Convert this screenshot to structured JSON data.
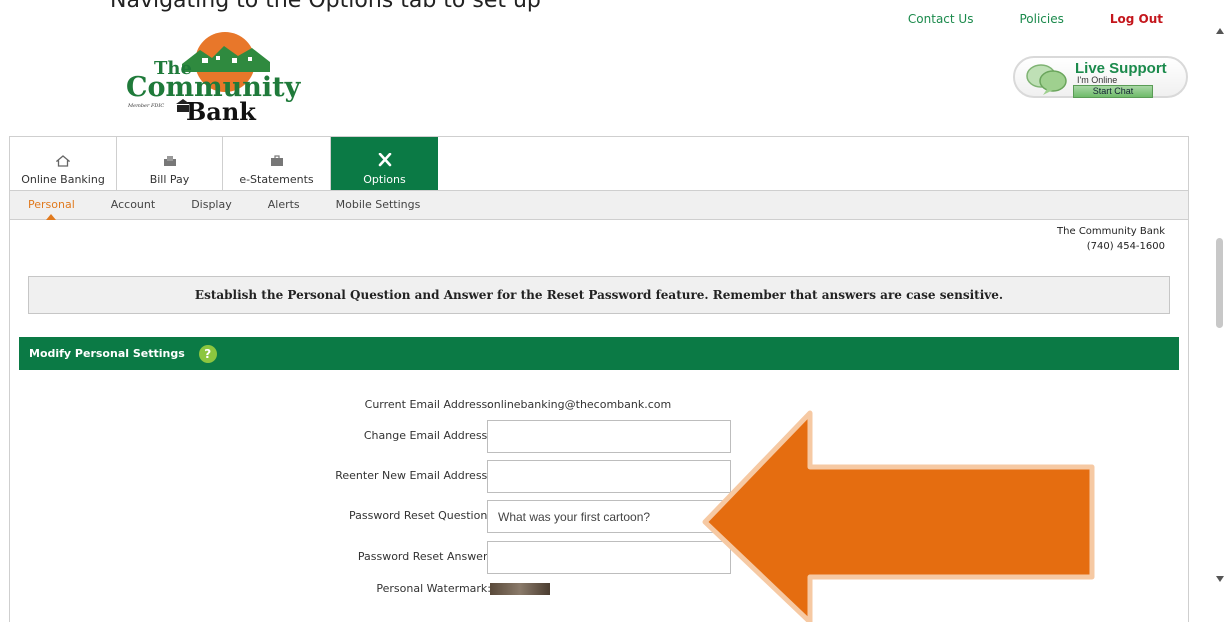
{
  "caption": "Navigating to the Options tab to set up",
  "header": {
    "links": {
      "contact": "Contact Us",
      "policies": "Policies",
      "logout": "Log Out"
    },
    "logo": {
      "line1": "The",
      "line2": "Community",
      "line3": "Bank",
      "member": "Member FDIC"
    }
  },
  "live_support": {
    "title": "Live Support",
    "status": "I'm Online",
    "button": "Start Chat"
  },
  "main_tabs": [
    {
      "label": "Online Banking",
      "icon": "home-icon"
    },
    {
      "label": "Bill Pay",
      "icon": "bill-pay-icon"
    },
    {
      "label": "e-Statements",
      "icon": "briefcase-icon"
    },
    {
      "label": "Options",
      "icon": "tools-icon"
    }
  ],
  "sub_tabs": [
    "Personal",
    "Account",
    "Display",
    "Alerts",
    "Mobile Settings"
  ],
  "bank_info": {
    "name": "The Community Bank",
    "phone": "(740) 454-1600"
  },
  "notice": "Establish the Personal Question and Answer for the Reset Password feature. Remember that answers are case sensitive.",
  "section": {
    "title": "Modify Personal Settings",
    "help": "?"
  },
  "form": {
    "current_email_label": "Current Email Address:",
    "current_email_value": "onlinebanking@thecombank.com",
    "change_email_label": "Change Email Address:",
    "change_email_value": "",
    "reenter_email_label": "Reenter New Email Address:",
    "reenter_email_value": "",
    "question_label": "Password Reset Question:",
    "question_value": "What was your first cartoon?",
    "answer_label": "Password Reset Answer:",
    "answer_value": "",
    "watermark_label": "Personal Watermark:"
  },
  "colors": {
    "brand_green": "#0b7a45",
    "accent_orange": "#e07a1f",
    "logout_red": "#c4161c",
    "arrow_orange": "#e56d10"
  }
}
